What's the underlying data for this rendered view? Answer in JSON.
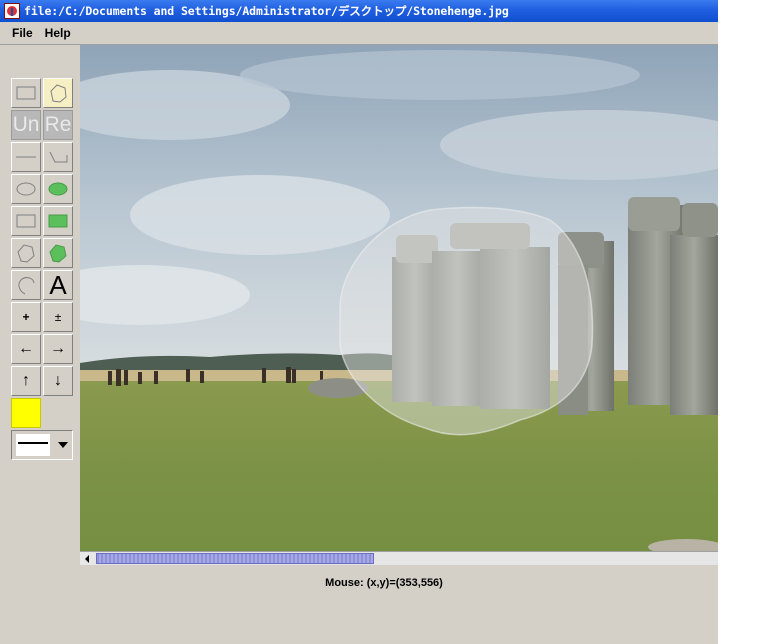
{
  "window": {
    "title": "file:/C:/Documents and Settings/Administrator/デスクトップ/Stonehenge.jpg"
  },
  "menu": {
    "items": [
      "File",
      "Help"
    ]
  },
  "toolbar": {
    "undo_label": "Un",
    "redo_label": "Re",
    "text_label": "A",
    "zoom_in_label": "+",
    "zoom_toggle_label": "±",
    "left_label": "←",
    "right_label": "→",
    "up_label": "↑",
    "down_label": "↓",
    "selected_tool": "freeform-select",
    "current_color": "#ffff00"
  },
  "canvas": {
    "image_name": "Stonehenge.jpg"
  },
  "status": {
    "mouse_text": "Mouse: (x,y)=(353,556)"
  },
  "colors": {
    "titlebar": "#0f4fd0",
    "window_bg": "#d4d0c8",
    "fill_color": "#ffff00",
    "selection_bg": "#f7efc4",
    "scroll_thumb": "#a7a9e6"
  }
}
